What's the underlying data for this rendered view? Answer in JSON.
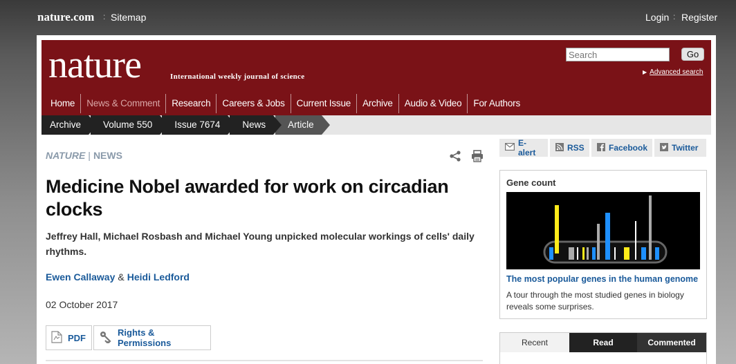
{
  "topbar": {
    "site": "nature.com",
    "separator": ":",
    "sitemap": "Sitemap",
    "login": "Login",
    "separator2": ":",
    "register": "Register"
  },
  "masthead": {
    "logo": "nature",
    "tagline": "International weekly journal of science",
    "search_placeholder": "Search",
    "go_label": "Go",
    "advanced_search": "Advanced search",
    "brand_color": "#7a1217"
  },
  "mainnav": [
    "Home",
    "News & Comment",
    "Research",
    "Careers & Jobs",
    "Current Issue",
    "Archive",
    "Audio & Video",
    "For Authors"
  ],
  "breadcrumb": [
    "Archive",
    "Volume 550",
    "Issue 7674",
    "News",
    "Article"
  ],
  "article": {
    "section_journal": "NATURE",
    "section_sep": "|",
    "section_type": "NEWS",
    "headline": "Medicine Nobel awarded for work on circadian clocks",
    "standfirst": "Jeffrey Hall, Michael Rosbash and Michael Young unpicked molecular workings of cells' daily rhythms.",
    "author1": "Ewen Callaway",
    "author_sep": "&",
    "author2": "Heidi Ledford",
    "date": "02 October 2017",
    "pdf_label": "PDF",
    "rights_label": "Rights & Permissions"
  },
  "social": {
    "email": "E-alert",
    "rss": "RSS",
    "facebook": "Facebook",
    "twitter": "Twitter"
  },
  "genebox": {
    "title": "Gene count",
    "link": "The most popular genes in the human genome",
    "description": "A tour through the most studied genes in biology reveals some surprises."
  },
  "tabs": {
    "recent": "Recent",
    "read": "Read",
    "commented": "Commented"
  }
}
